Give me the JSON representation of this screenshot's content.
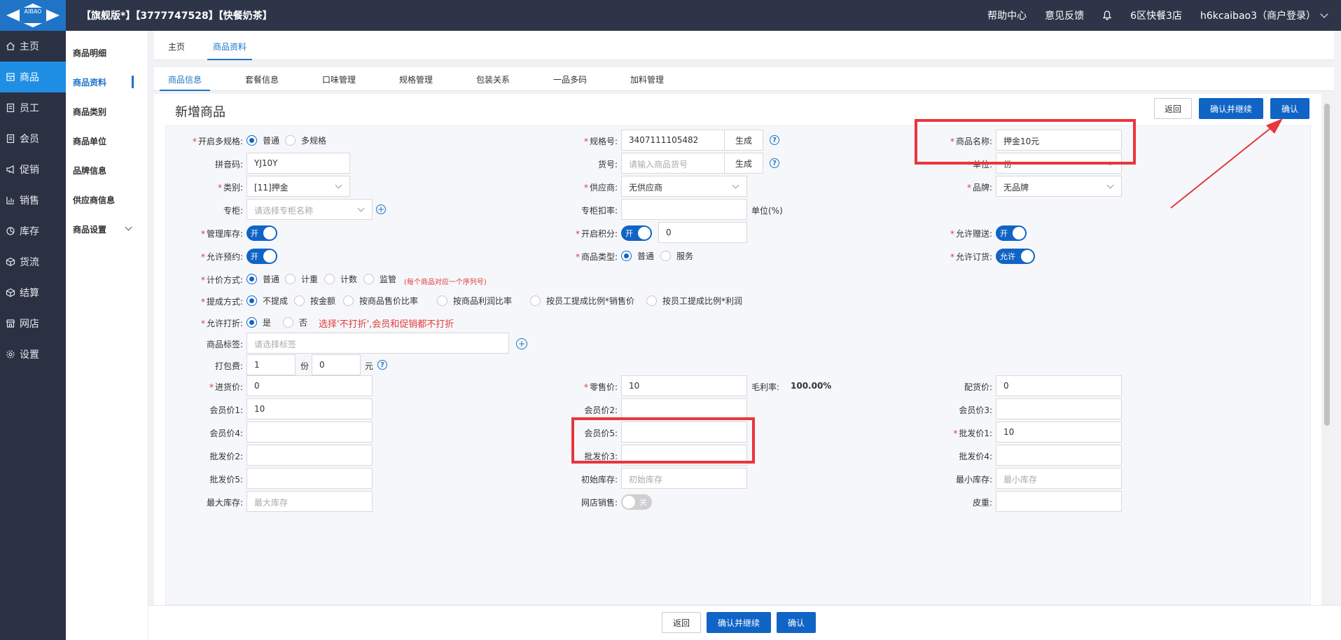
{
  "header": {
    "logo_text": "AIBAO",
    "store_title": "【旗舰版*】【3777747528】【快餐奶茶】",
    "help_center": "帮助中心",
    "feedback": "意见反馈",
    "store_name": "6区快餐3店",
    "account": "h6kcaibao3（商户登录）"
  },
  "leftnav": [
    "主页",
    "商品",
    "员工",
    "会员",
    "促销",
    "销售",
    "库存",
    "货流",
    "结算",
    "网店",
    "设置"
  ],
  "subnav": [
    "商品明细",
    "商品资料",
    "商品类别",
    "商品单位",
    "品牌信息",
    "供应商信息",
    "商品设置"
  ],
  "crumbs": [
    "主页",
    "商品资料"
  ],
  "tabs": [
    "商品信息",
    "套餐信息",
    "口味管理",
    "规格管理",
    "包装关系",
    "一品多码",
    "加料管理"
  ],
  "page": {
    "title": "新增商品",
    "back": "返回",
    "confirm_continue": "确认并继续",
    "confirm": "确认"
  },
  "form": {
    "multi_spec_label": "开启多规格:",
    "multi_spec_opt1": "普通",
    "multi_spec_opt2": "多规格",
    "spec_no_label": "规格号:",
    "spec_no_value": "3407111105482",
    "generate": "生成",
    "name_label": "商品名称:",
    "name_value": "押金10元",
    "pinyin_label": "拼音码:",
    "pinyin_value": "YJ10Y",
    "item_no_label": "货号:",
    "item_no_placeholder": "请输入商品货号",
    "unit_label": "单位:",
    "unit_value": "份",
    "category_label": "类别:",
    "category_value": "[11]押金",
    "supplier_label": "供应商:",
    "supplier_value": "无供应商",
    "brand_label": "品牌:",
    "brand_value": "无品牌",
    "counter_label": "专柜:",
    "counter_placeholder": "请选择专柜名称",
    "counter_rate_label": "专柜扣率:",
    "counter_rate_unit": "单位(%)",
    "manage_stock_label": "管理库存:",
    "toggle_on": "开",
    "toggle_off": "关",
    "points_label": "开启积分:",
    "points_value": "0",
    "allow_gift_label": "允许赠送:",
    "allow_reserve_label": "允许预约:",
    "item_type_label": "商品类型:",
    "item_type_opt1": "普通",
    "item_type_opt2": "服务",
    "allow_order_label": "允许订货:",
    "allow_order_toggle": "允许",
    "pricing_label": "计价方式:",
    "pricing_opts": [
      "普通",
      "计重",
      "计数",
      "监管"
    ],
    "pricing_note": "(每个商品对应一个序列号)",
    "commission_label": "提成方式:",
    "commission_opts": [
      "不提成",
      "按金额",
      "按商品售价比率",
      "按商品利润比率",
      "按员工提成比例*销售价",
      "按员工提成比例*利润"
    ],
    "discount_label": "允许打折:",
    "discount_yes": "是",
    "discount_no": "否",
    "discount_note": "选择'不打折',会员和促销都不打折",
    "tag_label": "商品标签:",
    "tag_placeholder": "请选择标签",
    "pack_fee_label": "打包费:",
    "pack_fee_qty": "1",
    "pack_fee_unit1": "份",
    "pack_fee_price": "0",
    "pack_fee_unit2": "元",
    "purchase_label": "进货价:",
    "purchase_value": "0",
    "retail_label": "零售价:",
    "retail_value": "10",
    "margin_label": "毛利率:",
    "margin_value": "100.00%",
    "dist_label": "配货价:",
    "dist_value": "0",
    "member1_label": "会员价1:",
    "member1_value": "10",
    "member2_label": "会员价2:",
    "member3_label": "会员价3:",
    "member4_label": "会员价4:",
    "member5_label": "会员价5:",
    "wholesale1_label": "批发价1:",
    "wholesale1_value": "10",
    "wholesale2_label": "批发价2:",
    "wholesale3_label": "批发价3:",
    "wholesale4_label": "批发价4:",
    "wholesale5_label": "批发价5:",
    "init_stock_label": "初始库存:",
    "init_stock_placeholder": "初始库存",
    "min_stock_label": "最小库存:",
    "min_stock_placeholder": "最小库存",
    "max_stock_label": "最大库存:",
    "max_stock_placeholder": "最大库存",
    "online_label": "网店销售:",
    "tare_label": "皮重:"
  },
  "colors": {
    "primary": "#1064c5",
    "topbar": "#2e3548",
    "sidebar_active": "#1f8fe5",
    "highlight": "#e8363c",
    "required": "#e43a3a"
  }
}
